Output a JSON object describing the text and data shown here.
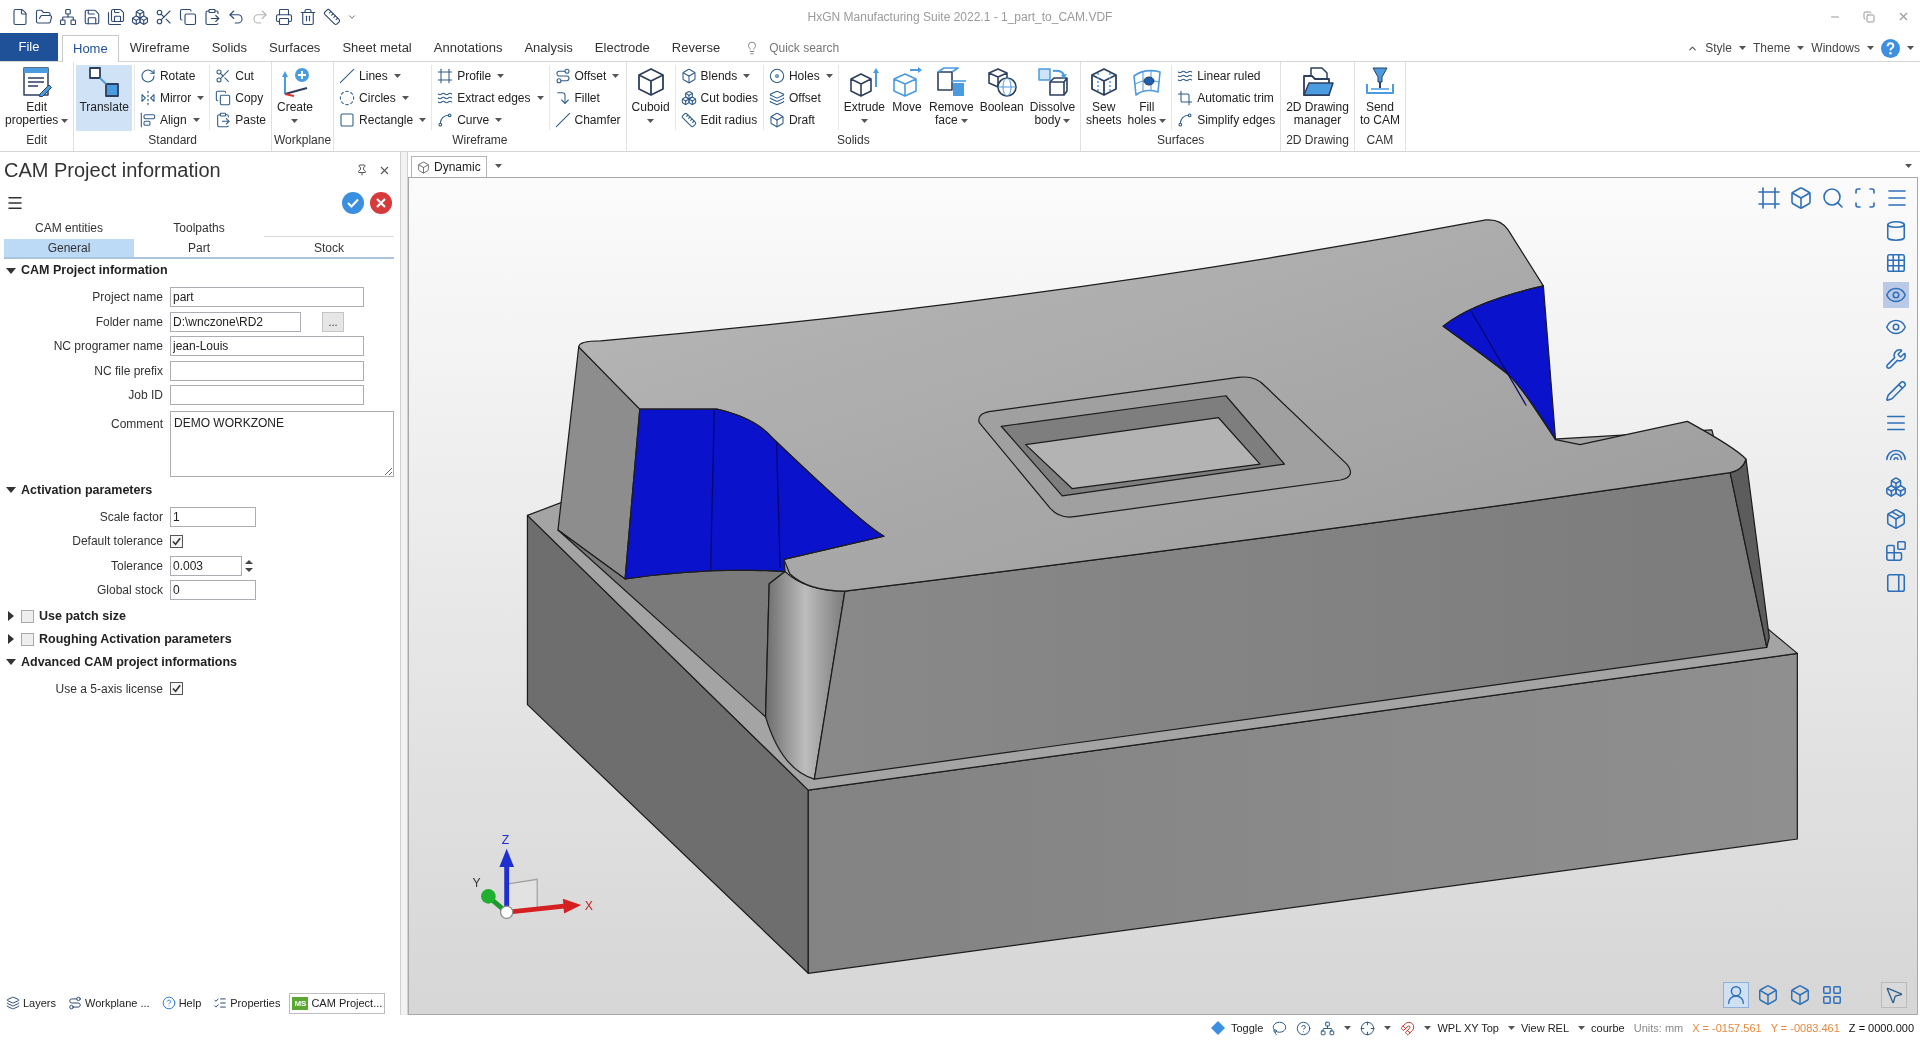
{
  "window": {
    "title": "HxGN Manufacturing Suite 2022.1 - 1_part_to_CAM.VDF"
  },
  "menu_tabs": [
    {
      "label": "File",
      "kind": "file",
      "selected": false
    },
    {
      "label": "Home",
      "kind": "tab",
      "selected": true
    },
    {
      "label": "Wireframe",
      "kind": "tab",
      "selected": false
    },
    {
      "label": "Solids",
      "kind": "tab",
      "selected": false
    },
    {
      "label": "Surfaces",
      "kind": "tab",
      "selected": false
    },
    {
      "label": "Sheet metal",
      "kind": "tab",
      "selected": false
    },
    {
      "label": "Annotations",
      "kind": "tab",
      "selected": false
    },
    {
      "label": "Analysis",
      "kind": "tab",
      "selected": false
    },
    {
      "label": "Electrode",
      "kind": "tab",
      "selected": false
    },
    {
      "label": "Reverse",
      "kind": "tab",
      "selected": false
    }
  ],
  "quick_search": {
    "placeholder": "Quick search"
  },
  "ribbon_options": [
    "Style",
    "Theme",
    "Windows"
  ],
  "ribbon": [
    {
      "title": "Edit",
      "columns": [
        {
          "kind": "large",
          "label": "Edit\nproperties",
          "dropdown": true,
          "active": false
        }
      ]
    },
    {
      "title": "Standard",
      "columns": [
        {
          "kind": "large",
          "label": "Translate",
          "dropdown": false,
          "active": true
        },
        {
          "kind": "stack",
          "items": [
            {
              "label": "Rotate",
              "dropdown": false
            },
            {
              "label": "Mirror",
              "dropdown": true
            },
            {
              "label": "Align",
              "dropdown": true
            }
          ]
        },
        {
          "kind": "stack",
          "items": [
            {
              "label": "Cut",
              "dropdown": false
            },
            {
              "label": "Copy",
              "dropdown": false
            },
            {
              "label": "Paste",
              "dropdown": false
            }
          ]
        }
      ]
    },
    {
      "title": "Workplane",
      "columns": [
        {
          "kind": "large",
          "label": "Create",
          "dropdown": true,
          "active": false
        }
      ]
    },
    {
      "title": "Wireframe",
      "columns": [
        {
          "kind": "stack",
          "items": [
            {
              "label": "Lines",
              "dropdown": true
            },
            {
              "label": "Circles",
              "dropdown": true
            },
            {
              "label": "Rectangle",
              "dropdown": true
            }
          ]
        },
        {
          "kind": "stack",
          "items": [
            {
              "label": "Profile",
              "dropdown": true
            },
            {
              "label": "Extract edges",
              "dropdown": true
            },
            {
              "label": "Curve",
              "dropdown": true
            }
          ]
        },
        {
          "kind": "stack",
          "items": [
            {
              "label": "Offset",
              "dropdown": true
            },
            {
              "label": "Fillet",
              "dropdown": false
            },
            {
              "label": "Chamfer",
              "dropdown": false
            }
          ]
        }
      ]
    },
    {
      "title": "Solids",
      "columns": [
        {
          "kind": "large",
          "label": "Cuboid",
          "dropdown": true,
          "active": false
        },
        {
          "kind": "stack",
          "items": [
            {
              "label": "Blends",
              "dropdown": true
            },
            {
              "label": "Cut bodies",
              "dropdown": false
            },
            {
              "label": "Edit radius",
              "dropdown": false
            }
          ]
        },
        {
          "kind": "stack",
          "items": [
            {
              "label": "Holes",
              "dropdown": true
            },
            {
              "label": "Offset",
              "dropdown": false
            },
            {
              "label": "Draft",
              "dropdown": false
            }
          ]
        },
        {
          "kind": "large",
          "label": "Extrude",
          "dropdown": true,
          "active": false
        },
        {
          "kind": "large",
          "label": "Move",
          "dropdown": false,
          "active": false
        },
        {
          "kind": "large",
          "label": "Remove\nface",
          "dropdown": true,
          "active": false
        },
        {
          "kind": "large",
          "label": "Boolean",
          "dropdown": false,
          "active": false
        },
        {
          "kind": "large",
          "label": "Dissolve\nbody",
          "dropdown": true,
          "active": false
        }
      ]
    },
    {
      "title": "Surfaces",
      "columns": [
        {
          "kind": "large",
          "label": "Sew\nsheets",
          "dropdown": false,
          "active": false
        },
        {
          "kind": "large",
          "label": "Fill\nholes",
          "dropdown": true,
          "active": false
        },
        {
          "kind": "stack",
          "items": [
            {
              "label": "Linear ruled",
              "dropdown": false
            },
            {
              "label": "Automatic trim",
              "dropdown": false
            },
            {
              "label": "Simplify edges",
              "dropdown": false
            }
          ]
        }
      ]
    },
    {
      "title": "2D Drawing",
      "columns": [
        {
          "kind": "large",
          "label": "2D Drawing\nmanager",
          "dropdown": false,
          "active": false
        }
      ]
    },
    {
      "title": "CAM",
      "columns": [
        {
          "kind": "large",
          "label": "Send\nto CAM",
          "dropdown": false,
          "active": false
        }
      ]
    }
  ],
  "panel": {
    "title": "CAM Project information",
    "tab_rows": [
      {
        "tabs": [
          {
            "label": "CAM entities",
            "selected": false
          },
          {
            "label": "Toolpaths",
            "selected": false
          }
        ]
      },
      {
        "tabs": [
          {
            "label": "General",
            "selected": true
          },
          {
            "label": "Part",
            "selected": false
          },
          {
            "label": "Stock",
            "selected": false
          }
        ]
      }
    ],
    "sections": [
      {
        "title": "CAM Project information",
        "expanded": true,
        "fields": [
          {
            "label": "Project name",
            "kind": "text",
            "value": "part"
          },
          {
            "label": "Folder name",
            "kind": "folder",
            "value": "D:\\wnczone\\RD2",
            "button": "..."
          },
          {
            "label": "NC programer name",
            "kind": "text",
            "value": "jean-Louis"
          },
          {
            "label": "NC file prefix",
            "kind": "text"
          },
          {
            "label": "Job ID",
            "kind": "text"
          },
          {
            "label": "Comment",
            "kind": "textarea",
            "value": "DEMO WORKZONE"
          }
        ]
      },
      {
        "title": "Activation parameters",
        "expanded": true,
        "fields": [
          {
            "label": "Scale factor",
            "kind": "short",
            "value": "1"
          },
          {
            "label": "Default tolerance",
            "kind": "checkbox",
            "checked": true
          },
          {
            "label": "Tolerance",
            "kind": "spinner",
            "value": "0.003"
          },
          {
            "label": "Global stock",
            "kind": "short",
            "value": "0"
          }
        ]
      },
      {
        "title": "Use patch size",
        "expanded": false,
        "checked": false
      },
      {
        "title": "Roughing Activation parameters",
        "expanded": false,
        "checked": false
      },
      {
        "title": "Advanced CAM project informations",
        "expanded": true,
        "fields": [
          {
            "label": "Use a 5-axis license",
            "kind": "checkbox",
            "checked": true
          }
        ]
      }
    ]
  },
  "panel_tabs": [
    {
      "label": "Layers",
      "selected": false
    },
    {
      "label": "Workplane ...",
      "selected": false
    },
    {
      "label": "Help",
      "selected": false
    },
    {
      "label": "Properties",
      "selected": false
    },
    {
      "label": "CAM Project...",
      "selected": true,
      "logo": "MS"
    }
  ],
  "document_tabs": [
    {
      "label": "Dynamic",
      "selected": true
    }
  ],
  "viewport": {
    "axis_labels": {
      "x": "X",
      "y": "Y",
      "z": "Z"
    },
    "side_tools": [
      {
        "on": false
      },
      {
        "on": false
      },
      {
        "on": true
      },
      {
        "on": false
      },
      {
        "on": false
      },
      {
        "on": false
      },
      {
        "on": false
      },
      {
        "on": false
      },
      {
        "on": false
      },
      {
        "on": false
      },
      {
        "on": false
      },
      {
        "on": false
      }
    ],
    "view_buttons": [
      {
        "selected": true
      },
      {
        "selected": false
      },
      {
        "selected": false
      },
      {
        "selected": false
      }
    ],
    "pointer_tool": {
      "on": true
    }
  },
  "status_bar": {
    "toggle": "Toggle",
    "selectors": [
      "WPL XY Top",
      "View REL",
      "courbe"
    ],
    "units": "Units: mm",
    "coordinates": [
      {
        "text": "X = -0157.561",
        "color": "#e5893f"
      },
      {
        "text": "Y = -0083.461",
        "color": "#e5893f"
      },
      {
        "text": "Z = 0000.000",
        "color": "#111111"
      }
    ]
  }
}
